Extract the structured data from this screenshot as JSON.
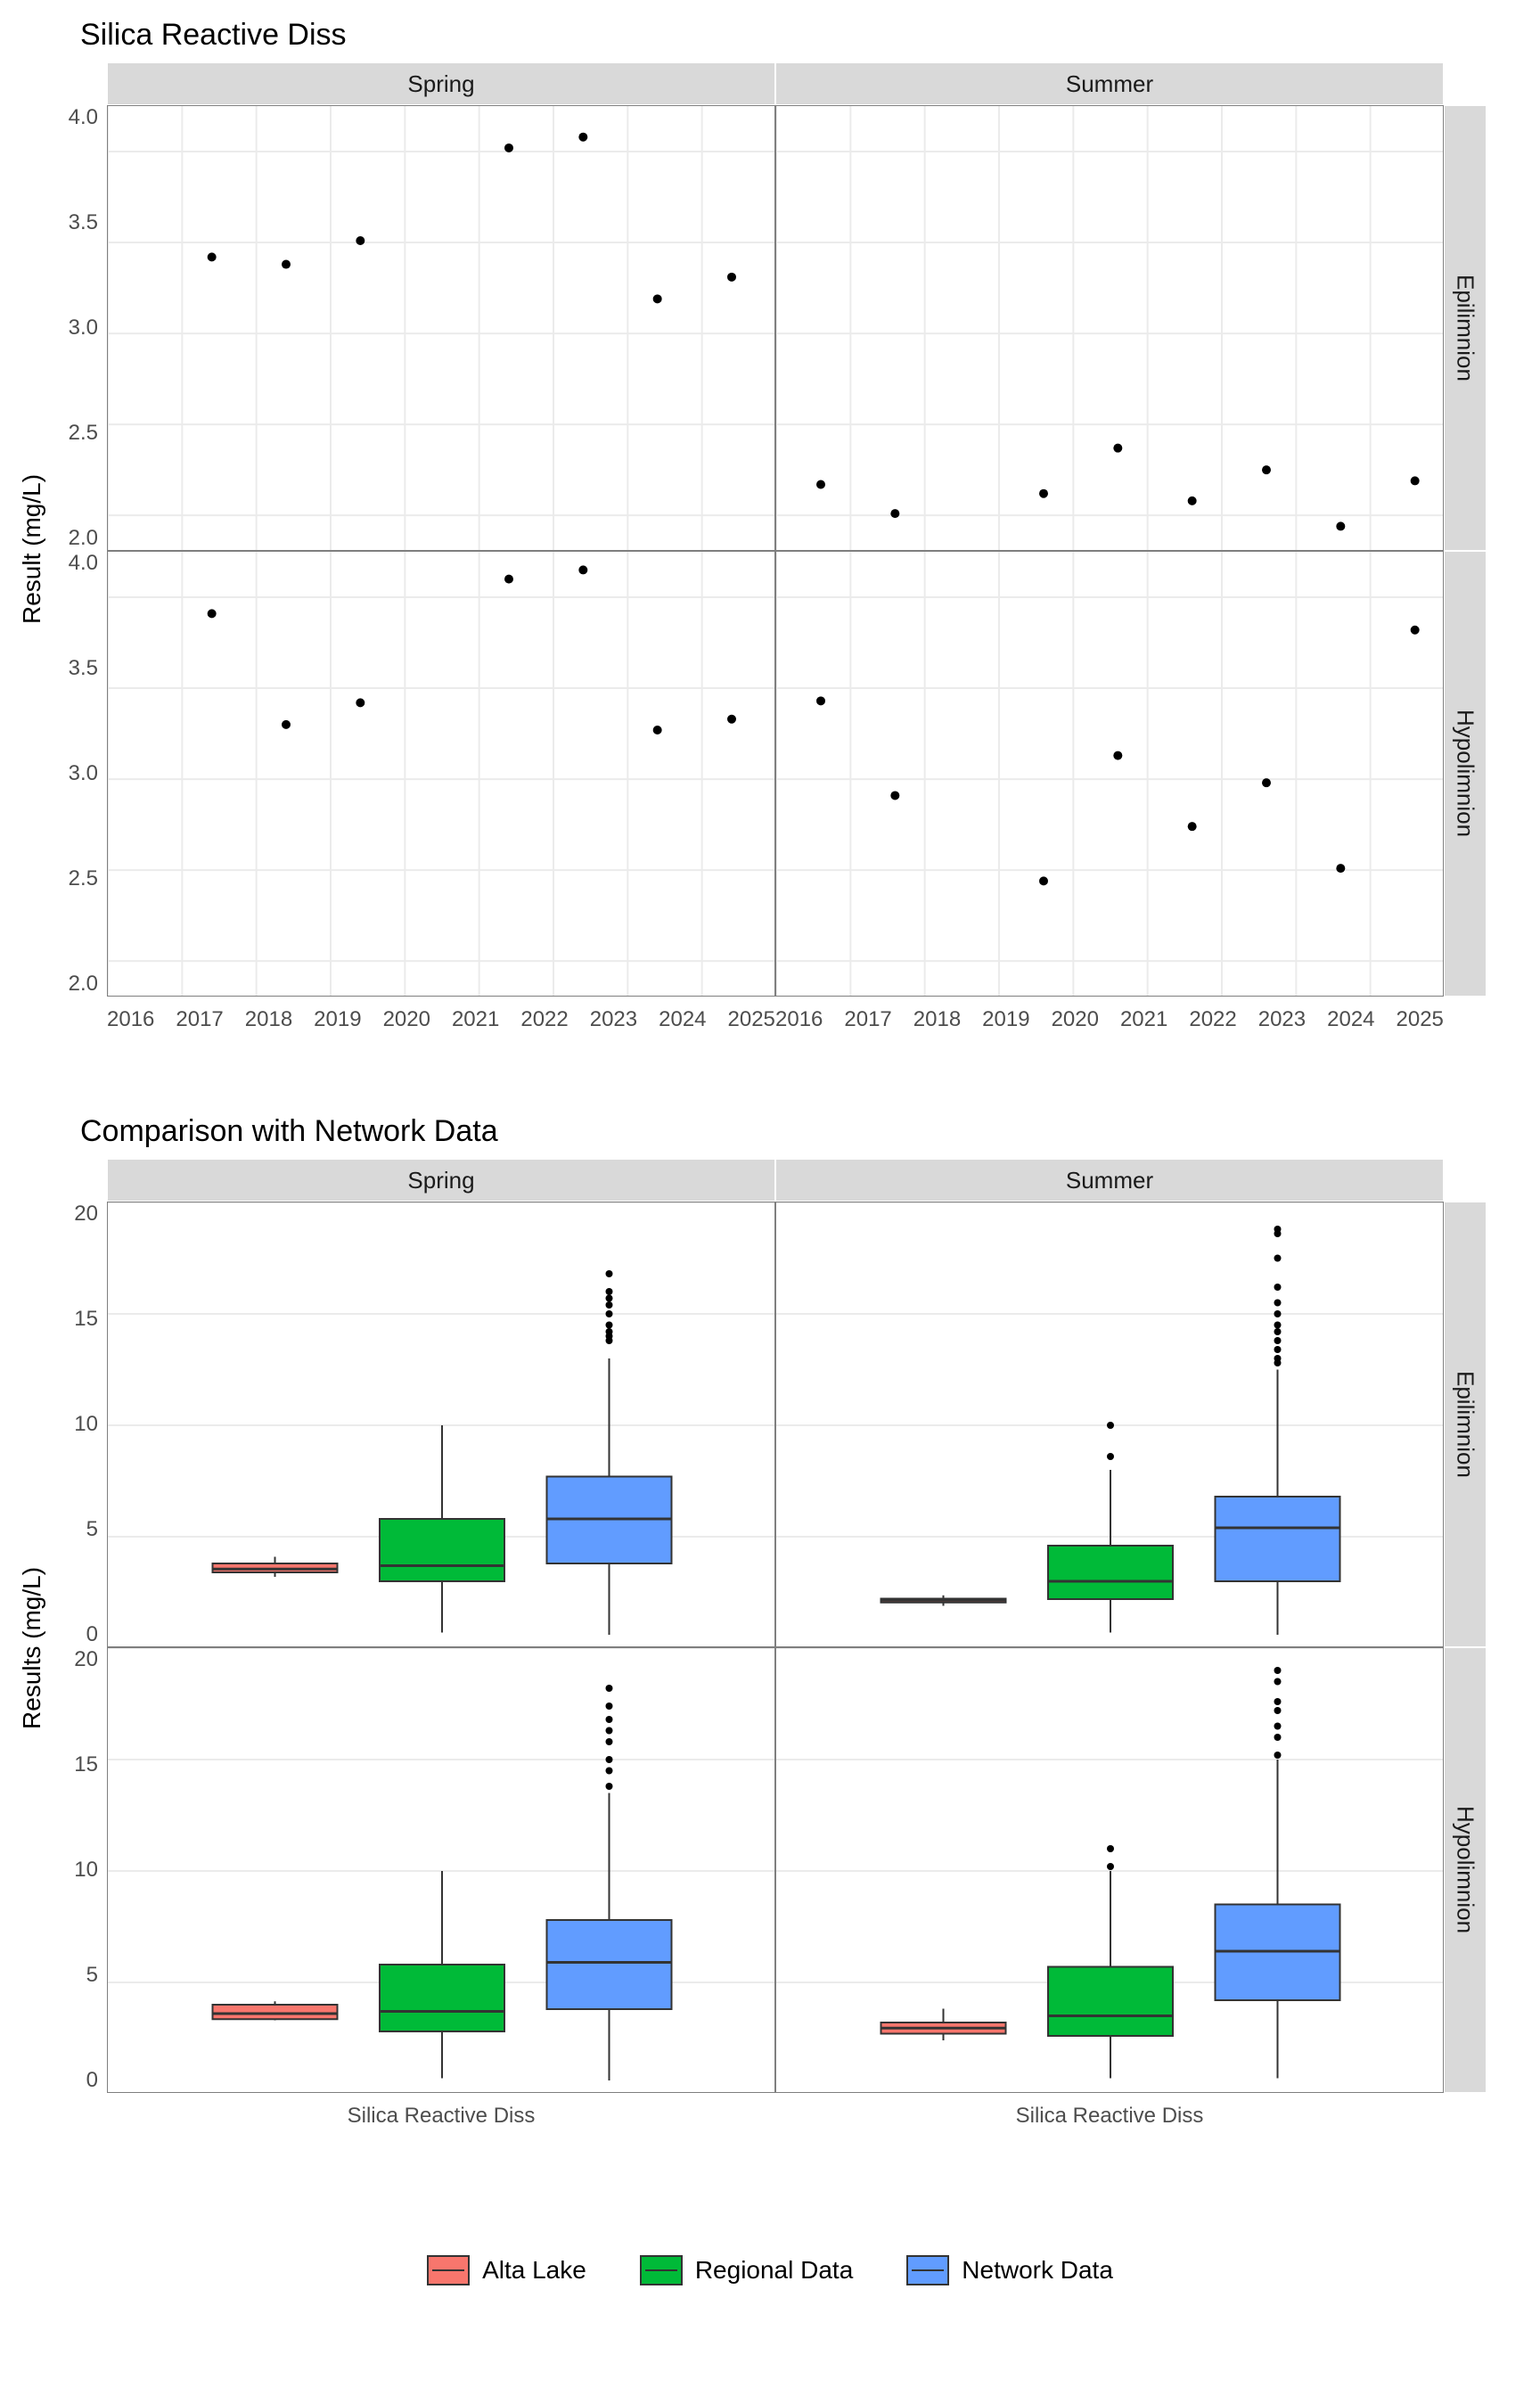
{
  "chart_data": [
    {
      "type": "scatter",
      "title": "Silica Reactive Diss",
      "xlabel": "",
      "ylabel": "Result (mg/L)",
      "facets": {
        "cols": [
          "Spring",
          "Summer"
        ],
        "rows": [
          "Epilimnion",
          "Hypolimnion"
        ]
      },
      "xlim": [
        2016,
        2025
      ],
      "ylim": [
        1.8,
        4.25
      ],
      "xticks": [
        2016,
        2017,
        2018,
        2019,
        2020,
        2021,
        2022,
        2023,
        2024,
        2025
      ],
      "yticks": [
        2.0,
        2.5,
        3.0,
        3.5,
        4.0
      ],
      "panels": {
        "Spring|Epilimnion": {
          "x": [
            2017.4,
            2018.4,
            2019.4,
            2021.4,
            2022.4,
            2023.4,
            2024.4
          ],
          "y": [
            3.42,
            3.38,
            3.51,
            4.02,
            4.08,
            3.19,
            3.31
          ]
        },
        "Summer|Epilimnion": {
          "x": [
            2016.6,
            2017.6,
            2019.6,
            2020.6,
            2021.6,
            2022.6,
            2023.6,
            2024.6
          ],
          "y": [
            2.17,
            2.01,
            2.12,
            2.37,
            2.08,
            2.25,
            1.94,
            2.19
          ]
        },
        "Spring|Hypolimnion": {
          "x": [
            2017.4,
            2018.4,
            2019.4,
            2021.4,
            2022.4,
            2023.4,
            2024.4
          ],
          "y": [
            3.91,
            3.3,
            3.42,
            4.1,
            4.15,
            3.27,
            3.33
          ]
        },
        "Summer|Hypolimnion": {
          "x": [
            2016.6,
            2017.6,
            2019.6,
            2020.6,
            2021.6,
            2022.6,
            2023.6,
            2024.6
          ],
          "y": [
            3.43,
            2.91,
            2.44,
            3.13,
            2.74,
            2.98,
            2.51,
            3.82
          ]
        }
      }
    },
    {
      "type": "box",
      "title": "Comparison with Network Data",
      "xlabel": "Silica Reactive Diss",
      "ylabel": "Results (mg/L)",
      "facets": {
        "cols": [
          "Spring",
          "Summer"
        ],
        "rows": [
          "Epilimnion",
          "Hypolimnion"
        ]
      },
      "ylim": [
        0,
        20
      ],
      "yticks": [
        0,
        5,
        10,
        15,
        20
      ],
      "groups": [
        "Alta Lake",
        "Regional Data",
        "Network Data"
      ],
      "colors": {
        "Alta Lake": "#F8766D",
        "Regional Data": "#00BA38",
        "Network Data": "#619CFF"
      },
      "panels": {
        "Spring|Epilimnion": {
          "Alta Lake": {
            "min": 3.2,
            "q1": 3.4,
            "med": 3.55,
            "q3": 3.8,
            "max": 4.1,
            "out": []
          },
          "Regional Data": {
            "min": 0.7,
            "q1": 3.0,
            "med": 3.7,
            "q3": 5.8,
            "max": 10.0,
            "out": []
          },
          "Network Data": {
            "min": 0.6,
            "q1": 3.8,
            "med": 5.8,
            "q3": 7.7,
            "max": 13.0,
            "out": [
              13.8,
              14.0,
              14.2,
              14.5,
              15.0,
              15.4,
              15.7,
              16.0,
              16.8
            ]
          }
        },
        "Summer|Epilimnion": {
          "Alta Lake": {
            "min": 1.9,
            "q1": 2.05,
            "med": 2.15,
            "q3": 2.22,
            "max": 2.37,
            "out": []
          },
          "Regional Data": {
            "min": 0.7,
            "q1": 2.2,
            "med": 3.0,
            "q3": 4.6,
            "max": 8.0,
            "out": [
              8.6,
              10.0
            ]
          },
          "Network Data": {
            "min": 0.6,
            "q1": 3.0,
            "med": 5.4,
            "q3": 6.8,
            "max": 12.5,
            "out": [
              12.8,
              13.0,
              13.4,
              13.8,
              14.2,
              14.5,
              15.0,
              15.5,
              16.2,
              17.5,
              18.6,
              18.8
            ]
          }
        },
        "Spring|Hypolimnion": {
          "Alta Lake": {
            "min": 3.3,
            "q1": 3.35,
            "med": 3.6,
            "q3": 4.0,
            "max": 4.15,
            "out": []
          },
          "Regional Data": {
            "min": 0.7,
            "q1": 2.8,
            "med": 3.7,
            "q3": 5.8,
            "max": 10.0,
            "out": []
          },
          "Network Data": {
            "min": 0.6,
            "q1": 3.8,
            "med": 5.9,
            "q3": 7.8,
            "max": 13.5,
            "out": [
              13.8,
              14.5,
              15.0,
              15.8,
              16.3,
              16.8,
              17.4,
              18.2
            ]
          }
        },
        "Summer|Hypolimnion": {
          "Alta Lake": {
            "min": 2.4,
            "q1": 2.7,
            "med": 2.95,
            "q3": 3.2,
            "max": 3.82,
            "out": []
          },
          "Regional Data": {
            "min": 0.7,
            "q1": 2.6,
            "med": 3.5,
            "q3": 5.7,
            "max": 10.0,
            "out": [
              10.2,
              11.0
            ]
          },
          "Network Data": {
            "min": 0.7,
            "q1": 4.2,
            "med": 6.4,
            "q3": 8.5,
            "max": 15.0,
            "out": [
              15.2,
              16.0,
              16.5,
              17.2,
              17.6,
              18.5,
              19.0
            ]
          }
        }
      }
    }
  ],
  "legend": {
    "items": [
      "Alta Lake",
      "Regional Data",
      "Network Data"
    ]
  }
}
